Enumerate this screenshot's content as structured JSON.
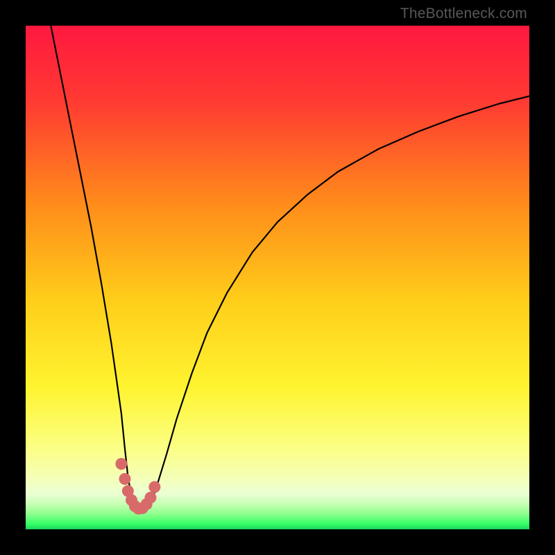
{
  "watermark": "TheBottleneck.com",
  "chart_data": {
    "type": "line",
    "title": "",
    "xlabel": "",
    "ylabel": "",
    "xlim": [
      0,
      100
    ],
    "ylim": [
      0,
      100
    ],
    "gradient_colors": {
      "top": "#ff1a48",
      "mid1": "#ff7a1f",
      "mid2": "#ffe31f",
      "mid3": "#f9ff7a",
      "bottom": "#1fff64"
    },
    "series": [
      {
        "name": "curve-left",
        "stroke": "#000000",
        "x": [
          5,
          7,
          9,
          11,
          13,
          15,
          17,
          18,
          19,
          19.7,
          20.3,
          21,
          22,
          23
        ],
        "y_pct": [
          100,
          90,
          80,
          70,
          60,
          49,
          37,
          30,
          23,
          16,
          10.5,
          6.5,
          4.0,
          3.2
        ]
      },
      {
        "name": "curve-right",
        "stroke": "#000000",
        "x": [
          23,
          24,
          25,
          26,
          28,
          30,
          33,
          36,
          40,
          45,
          50,
          56,
          62,
          70,
          78,
          86,
          94,
          100
        ],
        "y_pct": [
          3.2,
          3.8,
          5.5,
          8.5,
          15,
          22,
          31,
          39,
          47,
          55,
          61,
          66.5,
          71,
          75.5,
          79,
          82,
          84.5,
          86
        ]
      },
      {
        "name": "red-dots",
        "stroke": "#d86a6a",
        "marker": "circle",
        "x": [
          19.0,
          19.7,
          20.3,
          21.0,
          21.7,
          22.4,
          23.2,
          24.0,
          24.8,
          25.6
        ],
        "y_pct": [
          13.0,
          10.0,
          7.6,
          5.8,
          4.6,
          4.1,
          4.2,
          5.0,
          6.3,
          8.4
        ]
      }
    ],
    "notes": "y values are expressed as percent of plot height from bottom (0 = bottom edge). x values are percent of plot width from left."
  }
}
